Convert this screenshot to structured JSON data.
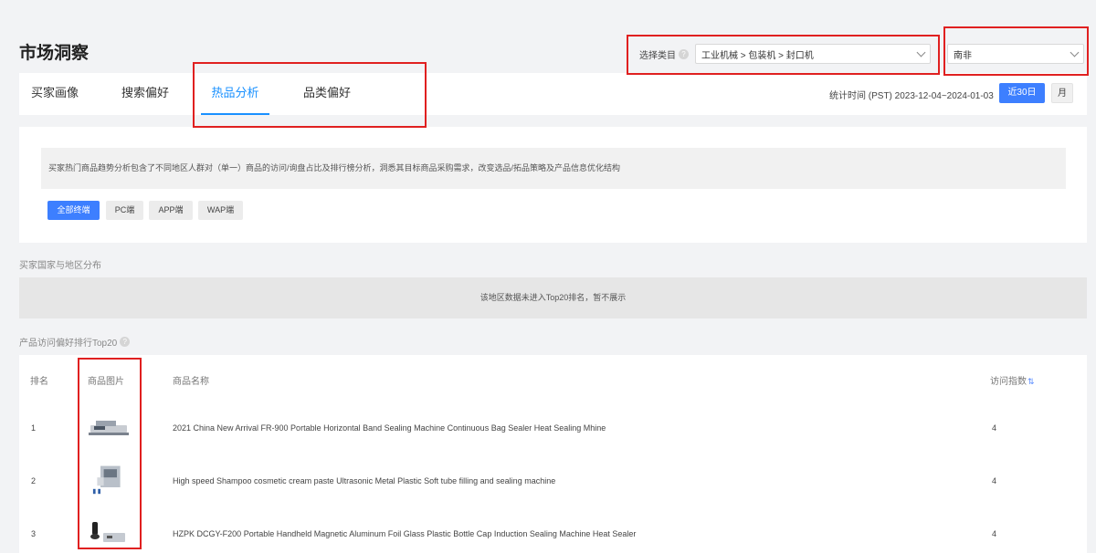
{
  "page": {
    "title": "市场洞察"
  },
  "category": {
    "label": "选择类目",
    "help": "?",
    "value": "工业机械 > 包装机 > 封口机"
  },
  "region": {
    "value": "南非"
  },
  "tabs": [
    {
      "label": "买家画像"
    },
    {
      "label": "搜索偏好"
    },
    {
      "label": "热品分析",
      "active": true
    },
    {
      "label": "品类偏好"
    }
  ],
  "stats": {
    "time": "统计时间 (PST) 2023-12-04~2024-01-03",
    "period_30": "近30日",
    "period_month": "月"
  },
  "intro": {
    "text": "买家热门商品趋势分析包含了不同地区人群对（单一）商品的访问/询盘占比及排行榜分析，洞悉其目标商品采购需求，改变选品/拓品策略及产品信息优化结构"
  },
  "terminals": [
    {
      "label": "全部终端",
      "active": true
    },
    {
      "label": "PC端"
    },
    {
      "label": "APP端"
    },
    {
      "label": "WAP端"
    }
  ],
  "region_section": {
    "title": "买家国家与地区分布",
    "empty": "该地区数据未进入Top20排名，暂不展示"
  },
  "ranking": {
    "title": "产品访问偏好排行Top20",
    "help": "?",
    "headers": {
      "rank": "排名",
      "image": "商品图片",
      "name": "商品名称",
      "visits": "访问指数",
      "sort": "⇅"
    },
    "rows": [
      {
        "rank": "1",
        "name": "2021 China New Arrival FR-900 Portable Horizontal Band Sealing Machine Continuous Bag Sealer Heat Sealing Mhine",
        "visits": "4",
        "image_icon": "band-sealer-image"
      },
      {
        "rank": "2",
        "name": "High speed Shampoo cosmetic cream paste Ultrasonic Metal Plastic Soft tube filling and sealing machine",
        "visits": "4",
        "image_icon": "tube-filler-image"
      },
      {
        "rank": "3",
        "name": "HZPK DCGY-F200 Portable Handheld Magnetic Aluminum Foil Glass Plastic Bottle Cap Induction Sealing Machine Heat Sealer",
        "visits": "4",
        "image_icon": "induction-sealer-image"
      }
    ]
  },
  "colors": {
    "accent": "#1890ff",
    "button_blue": "#3d7fff",
    "highlight_red": "#e02020"
  }
}
